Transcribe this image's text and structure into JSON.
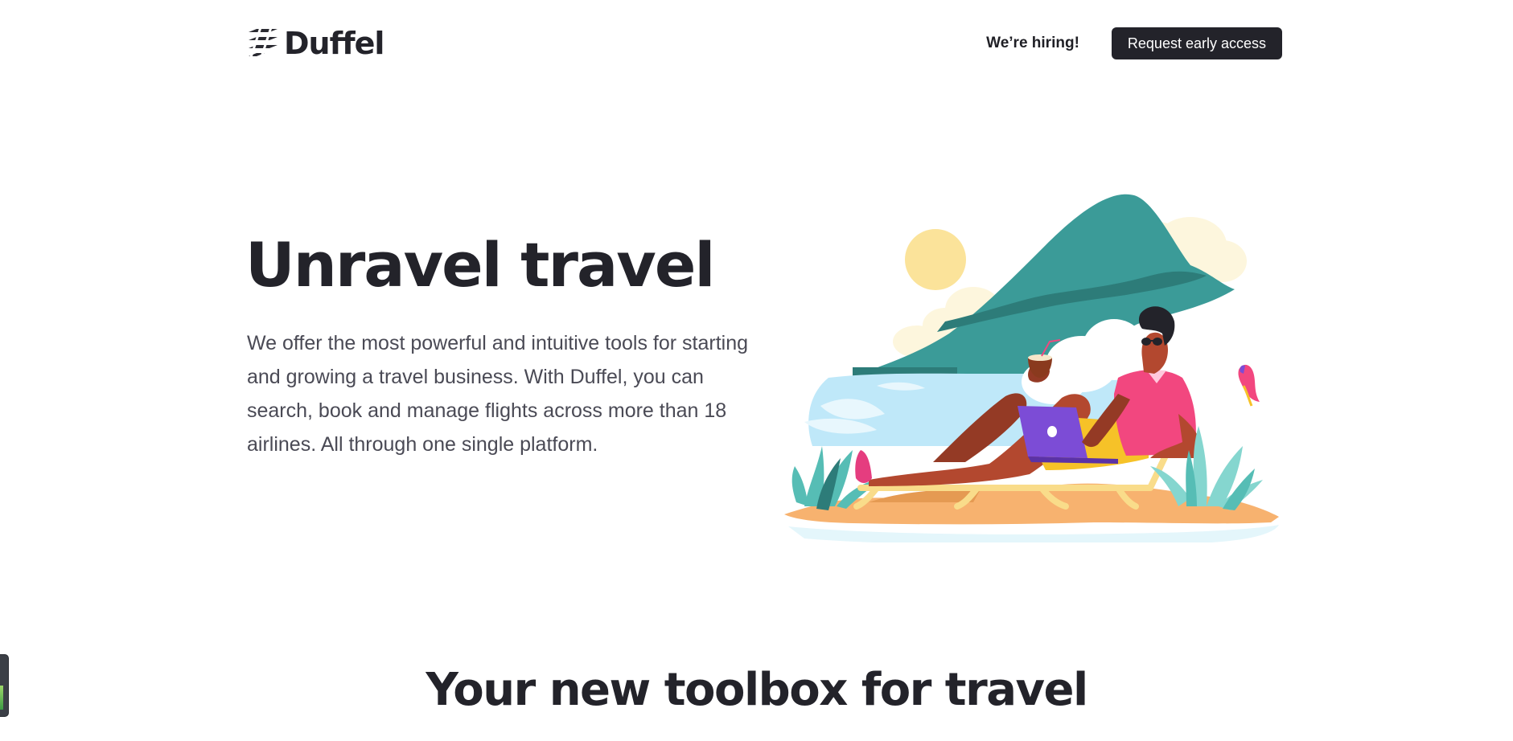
{
  "header": {
    "brand_name": "Duffel",
    "hiring_label": "We’re hiring!",
    "cta_label": "Request early access"
  },
  "hero": {
    "title": "Unravel travel",
    "description": "We offer the most powerful and intuitive tools for starting and growing a travel business. With Duffel, you can search, book and manage flights across more than 18 airlines. All through one single platform."
  },
  "section": {
    "title": "Your new toolbox for travel"
  },
  "colors": {
    "text_dark": "#23232a",
    "button_bg": "#23232a",
    "button_text": "#ffffff",
    "body_text": "#4a4a55",
    "teal": "#3b9b98",
    "shirt_pink": "#f2477f",
    "laptop_purple": "#7c4cd6",
    "sun_yellow": "#fbe39a",
    "sand": "#f7b26f",
    "water": "#bfe8f9"
  },
  "icons": {
    "logo": "duffel-logo-icon",
    "hero_illustration": "beach-traveler-illustration"
  }
}
